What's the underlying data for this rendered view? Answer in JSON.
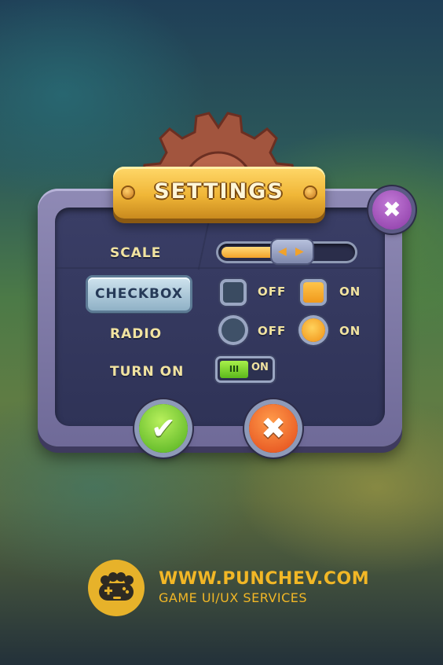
{
  "title": "SETTINGS",
  "close_symbol": "✖",
  "rows": {
    "scale": {
      "label": "SCALE",
      "slider_level": 0.45
    },
    "checkbox": {
      "label": "CHECKBOX",
      "off_label": "OFF",
      "on_label": "ON",
      "selected": "ON"
    },
    "radio": {
      "label": "RADIO",
      "off_label": "OFF",
      "on_label": "ON",
      "selected": "ON"
    },
    "turn_on": {
      "label": "TURN ON",
      "thumb_text": "III",
      "state_label": "ON"
    }
  },
  "buttons": {
    "confirm_symbol": "✔",
    "cancel_symbol": "✖"
  },
  "footer": {
    "url": "WWW.PUNCHEV.COM",
    "subtitle": "GAME UI/UX SERVICES"
  },
  "icons": {
    "close": "close-icon",
    "confirm": "checkmark-icon",
    "cancel": "cross-icon",
    "logo": "gamepad-brass-knuckles-icon",
    "slider_arrows": "left-right-arrows-icon"
  },
  "colors": {
    "accent_gold": "#f2b726",
    "panel_bg": "#34385e",
    "frame": "#8f8ab5",
    "label_text": "#f1e3a0",
    "ok_green": "#5cb81c",
    "cancel_orange": "#e2491a",
    "close_purple": "#a855c4"
  }
}
